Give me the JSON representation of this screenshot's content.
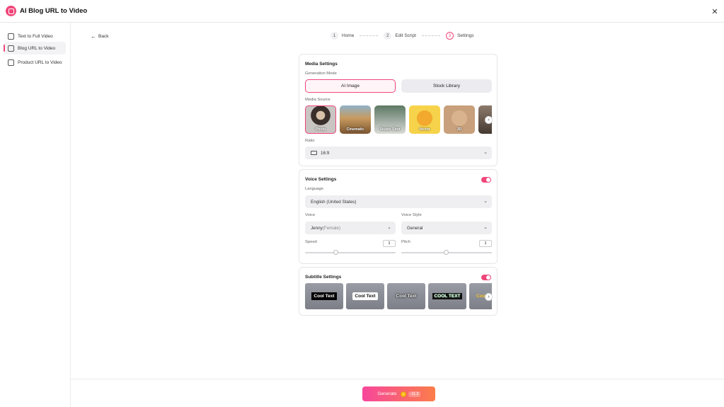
{
  "app": {
    "title": "AI Blog URL to Video"
  },
  "sidebar": {
    "items": [
      {
        "label": "Text to Full Video"
      },
      {
        "label": "Blog URL to Video"
      },
      {
        "label": "Product URL to Video"
      }
    ]
  },
  "nav": {
    "back_label": "Back"
  },
  "stepper": {
    "steps": [
      {
        "num": "1",
        "label": "Home"
      },
      {
        "num": "2",
        "label": "Edit Script"
      },
      {
        "num": "3",
        "label": "Settings"
      }
    ]
  },
  "media": {
    "title": "Media Settings",
    "generation_mode_label": "Generation Mode",
    "modes": [
      "AI Image",
      "Stock Library"
    ],
    "selected_mode": "AI Image",
    "source_label": "Media Source",
    "sources": [
      "Photo",
      "Cinematic",
      "Studio Shot",
      "Vector",
      "3D"
    ],
    "selected_source": "Photo",
    "ratio_label": "Ratio",
    "ratio_value": "16:9"
  },
  "voice": {
    "title": "Voice Settings",
    "enabled": true,
    "language_label": "Language",
    "language_value": "English (United States)",
    "voice_label": "Voice",
    "voice_name": "Jenny",
    "voice_gender": "(Female)",
    "style_label": "Voice Style",
    "style_value": "General",
    "speed_label": "Speed",
    "speed_value": "1",
    "pitch_label": "Pitch",
    "pitch_value": "1"
  },
  "subtitle": {
    "title": "Subtitle Settings",
    "enabled": true,
    "styles": [
      "Cool Text",
      "Cool Text",
      "Cool Text",
      "COOL TEXT",
      "Coo"
    ]
  },
  "footer": {
    "generate_label": "Generate",
    "cost": "-11.2"
  },
  "colors": {
    "accent": "#f0467a",
    "gradient_start": "#f7479b",
    "gradient_end": "#fb7d4a"
  }
}
